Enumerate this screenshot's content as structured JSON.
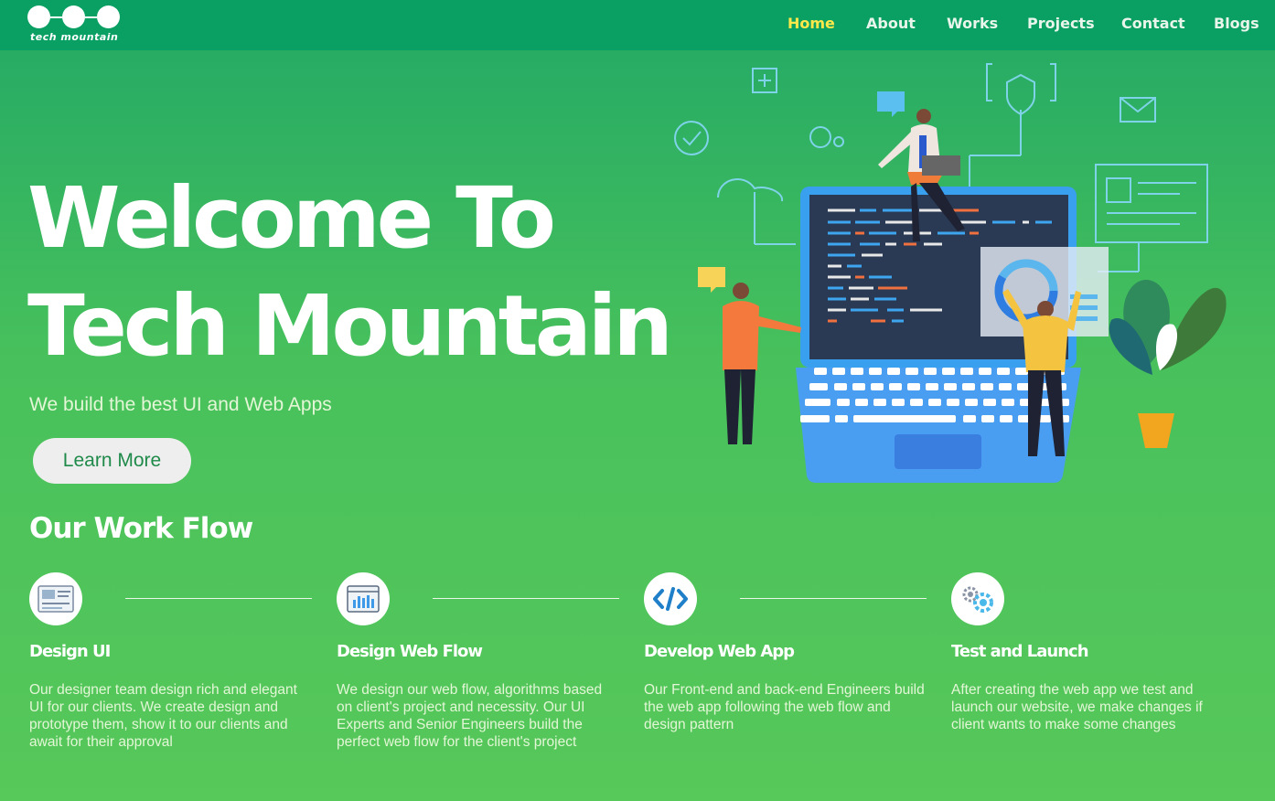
{
  "brand": {
    "logo_text": "tech mountain"
  },
  "nav": {
    "items": [
      {
        "label": "Home",
        "active": true
      },
      {
        "label": "About",
        "active": false
      },
      {
        "label": "Works",
        "active": false
      },
      {
        "label": "Projects",
        "active": false
      },
      {
        "label": "Contact",
        "active": false
      },
      {
        "label": "Blogs",
        "active": false
      }
    ]
  },
  "hero": {
    "title_line1": "Welcome To",
    "title_line2": "Tech Mountain",
    "subtitle": "We build the best UI and Web Apps",
    "cta_label": "Learn More"
  },
  "workflow": {
    "title": "Our Work Flow",
    "steps": [
      {
        "icon": "design-ui-icon",
        "title": "Design UI",
        "description": "Our designer team design rich and elegant UI for our clients. We create design and prototype them, show it to our clients and await for their approval"
      },
      {
        "icon": "web-flow-icon",
        "title": "Design Web Flow",
        "description": "We design our web flow, algorithms based on client's project and necessity. Our UI Experts and Senior Engineers build the perfect web flow for the client's project"
      },
      {
        "icon": "code-icon",
        "title": "Develop Web App",
        "description": "Our Front-end and back-end Engineers build the web app following the web flow and design pattern"
      },
      {
        "icon": "gears-icon",
        "title": "Test and Launch",
        "description": "After creating the web app we test and launch our website, we make changes if client wants to make some changes"
      }
    ]
  },
  "colors": {
    "nav_bg": "#0a9f63",
    "active_nav": "#ffe94a",
    "page_bg_top": "#22a866",
    "page_bg_bottom": "#57c85a",
    "button_bg": "#eeeeee",
    "button_text": "#1f8a4a"
  }
}
